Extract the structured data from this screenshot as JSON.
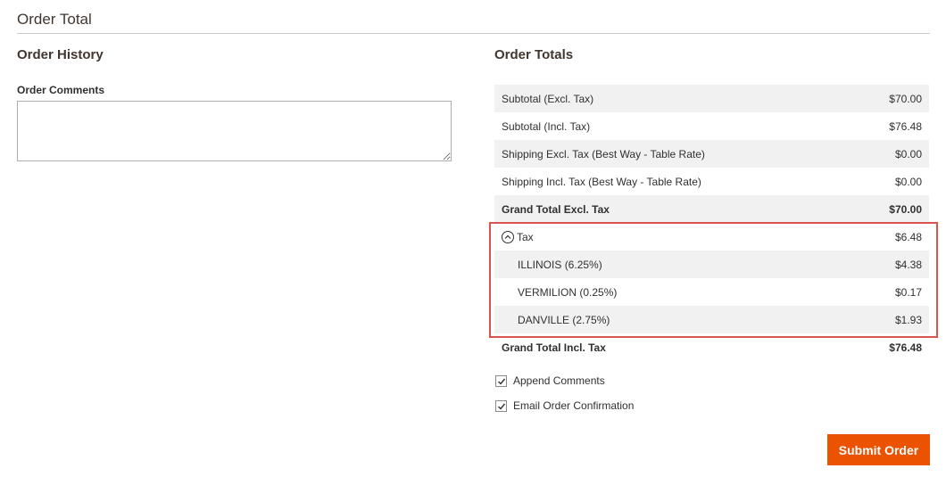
{
  "section": {
    "title": "Order Total"
  },
  "history": {
    "heading": "Order History",
    "comments_label": "Order Comments",
    "comments_value": ""
  },
  "totals": {
    "heading": "Order Totals",
    "rows": [
      {
        "label": "Subtotal (Excl. Tax)",
        "value": "$70.00"
      },
      {
        "label": "Subtotal (Incl. Tax)",
        "value": "$76.48"
      },
      {
        "label": "Shipping Excl. Tax (Best Way - Table Rate)",
        "value": "$0.00"
      },
      {
        "label": "Shipping Incl. Tax (Best Way - Table Rate)",
        "value": "$0.00"
      },
      {
        "label": "Grand Total Excl. Tax",
        "value": "$70.00"
      },
      {
        "label": "Tax",
        "value": "$6.48"
      },
      {
        "label": "ILLINOIS (6.25%)",
        "value": "$4.38"
      },
      {
        "label": "VERMILION (0.25%)",
        "value": "$0.17"
      },
      {
        "label": "DANVILLE (2.75%)",
        "value": "$1.93"
      },
      {
        "label": "Grand Total Incl. Tax",
        "value": "$76.48"
      }
    ]
  },
  "options": {
    "append_comments": {
      "label": "Append Comments",
      "checked": true
    },
    "email_confirmation": {
      "label": "Email Order Confirmation",
      "checked": true
    }
  },
  "actions": {
    "submit_label": "Submit Order"
  },
  "colors": {
    "accent": "#eb5202",
    "highlight": "#d9534f",
    "row_shade": "#f1f1f1"
  }
}
